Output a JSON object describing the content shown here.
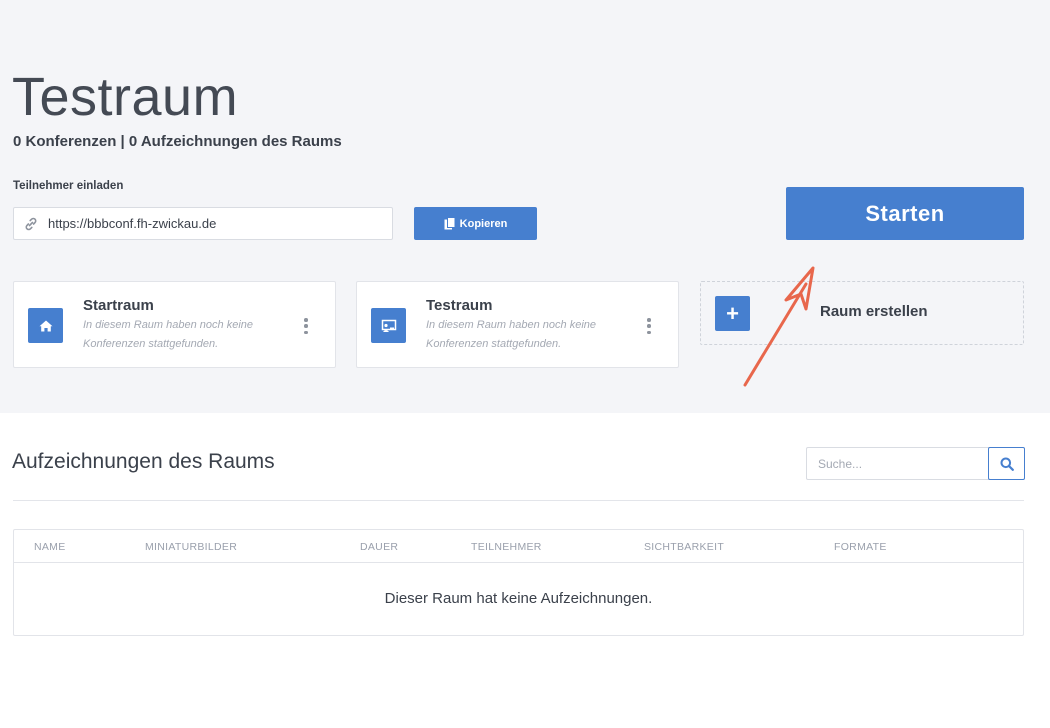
{
  "room": {
    "title": "Testraum",
    "stats": "0 Konferenzen | 0 Aufzeichnungen des Raums"
  },
  "invite": {
    "label": "Teilnehmer einladen",
    "url": "https://bbbconf.fh-zwickau.de",
    "copy_label": "Kopieren"
  },
  "start_label": "Starten",
  "rooms": [
    {
      "name": "Startraum",
      "description": "In diesem Raum haben noch keine Konferenzen stattgefunden.",
      "icon": "home-icon"
    },
    {
      "name": "Testraum",
      "description": "In diesem Raum haben noch keine Konferenzen stattgefunden.",
      "icon": "presentation-icon"
    }
  ],
  "create_room_label": "Raum erstellen",
  "recordings": {
    "title": "Aufzeichnungen des Raums",
    "search_placeholder": "Suche...",
    "columns": [
      "Name",
      "Miniaturbilder",
      "Dauer",
      "Teilnehmer",
      "Sichtbarkeit",
      "Formate"
    ],
    "empty_message": "Dieser Raum hat keine Aufzeichnungen."
  },
  "colors": {
    "accent": "#467fcf",
    "annotation_arrow": "#e8674c",
    "top_background": "#f4f5f8"
  }
}
